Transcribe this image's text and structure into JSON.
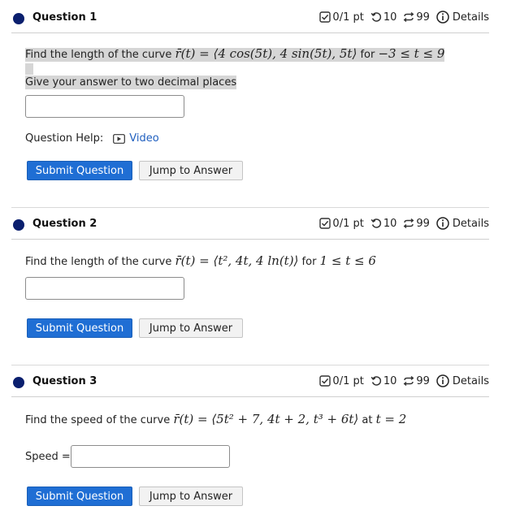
{
  "questions": [
    {
      "title": "Question 1",
      "score": "0/1 pt",
      "retries": "10",
      "attempts": "99",
      "details": "Details",
      "prompt": "Find the length of the curve ",
      "expr": "r̄(t) = ⟨4 cos(5t), 4 sin(5t), 5t⟩",
      "for_word": " for ",
      "range": "−3 ≤ t ≤ 9",
      "instruction": "Give your answer to two decimal places",
      "help_label": "Question Help:",
      "video_label": "Video",
      "submit_label": "Submit Question",
      "jump_label": "Jump to Answer"
    },
    {
      "title": "Question 2",
      "score": "0/1 pt",
      "retries": "10",
      "attempts": "99",
      "details": "Details",
      "prompt": "Find the length of the curve ",
      "expr": "r̄(t) = ⟨t², 4t, 4 ln(t)⟩",
      "for_word": " for ",
      "range": "1 ≤ t ≤ 6",
      "submit_label": "Submit Question",
      "jump_label": "Jump to Answer"
    },
    {
      "title": "Question 3",
      "score": "0/1 pt",
      "retries": "10",
      "attempts": "99",
      "details": "Details",
      "prompt": "Find the speed of the curve ",
      "expr": "r̄(t) = ⟨5t² + 7, 4t + 2, t³ + 6t⟩",
      "for_word": " at ",
      "range": "t = 2",
      "speed_label": "Speed =",
      "submit_label": "Submit Question",
      "jump_label": "Jump to Answer"
    }
  ],
  "colors": {
    "accent": "#1f6ed4",
    "dot": "#0a1f6e",
    "link": "#1f5fbf",
    "highlight": "#d6d6d6"
  }
}
